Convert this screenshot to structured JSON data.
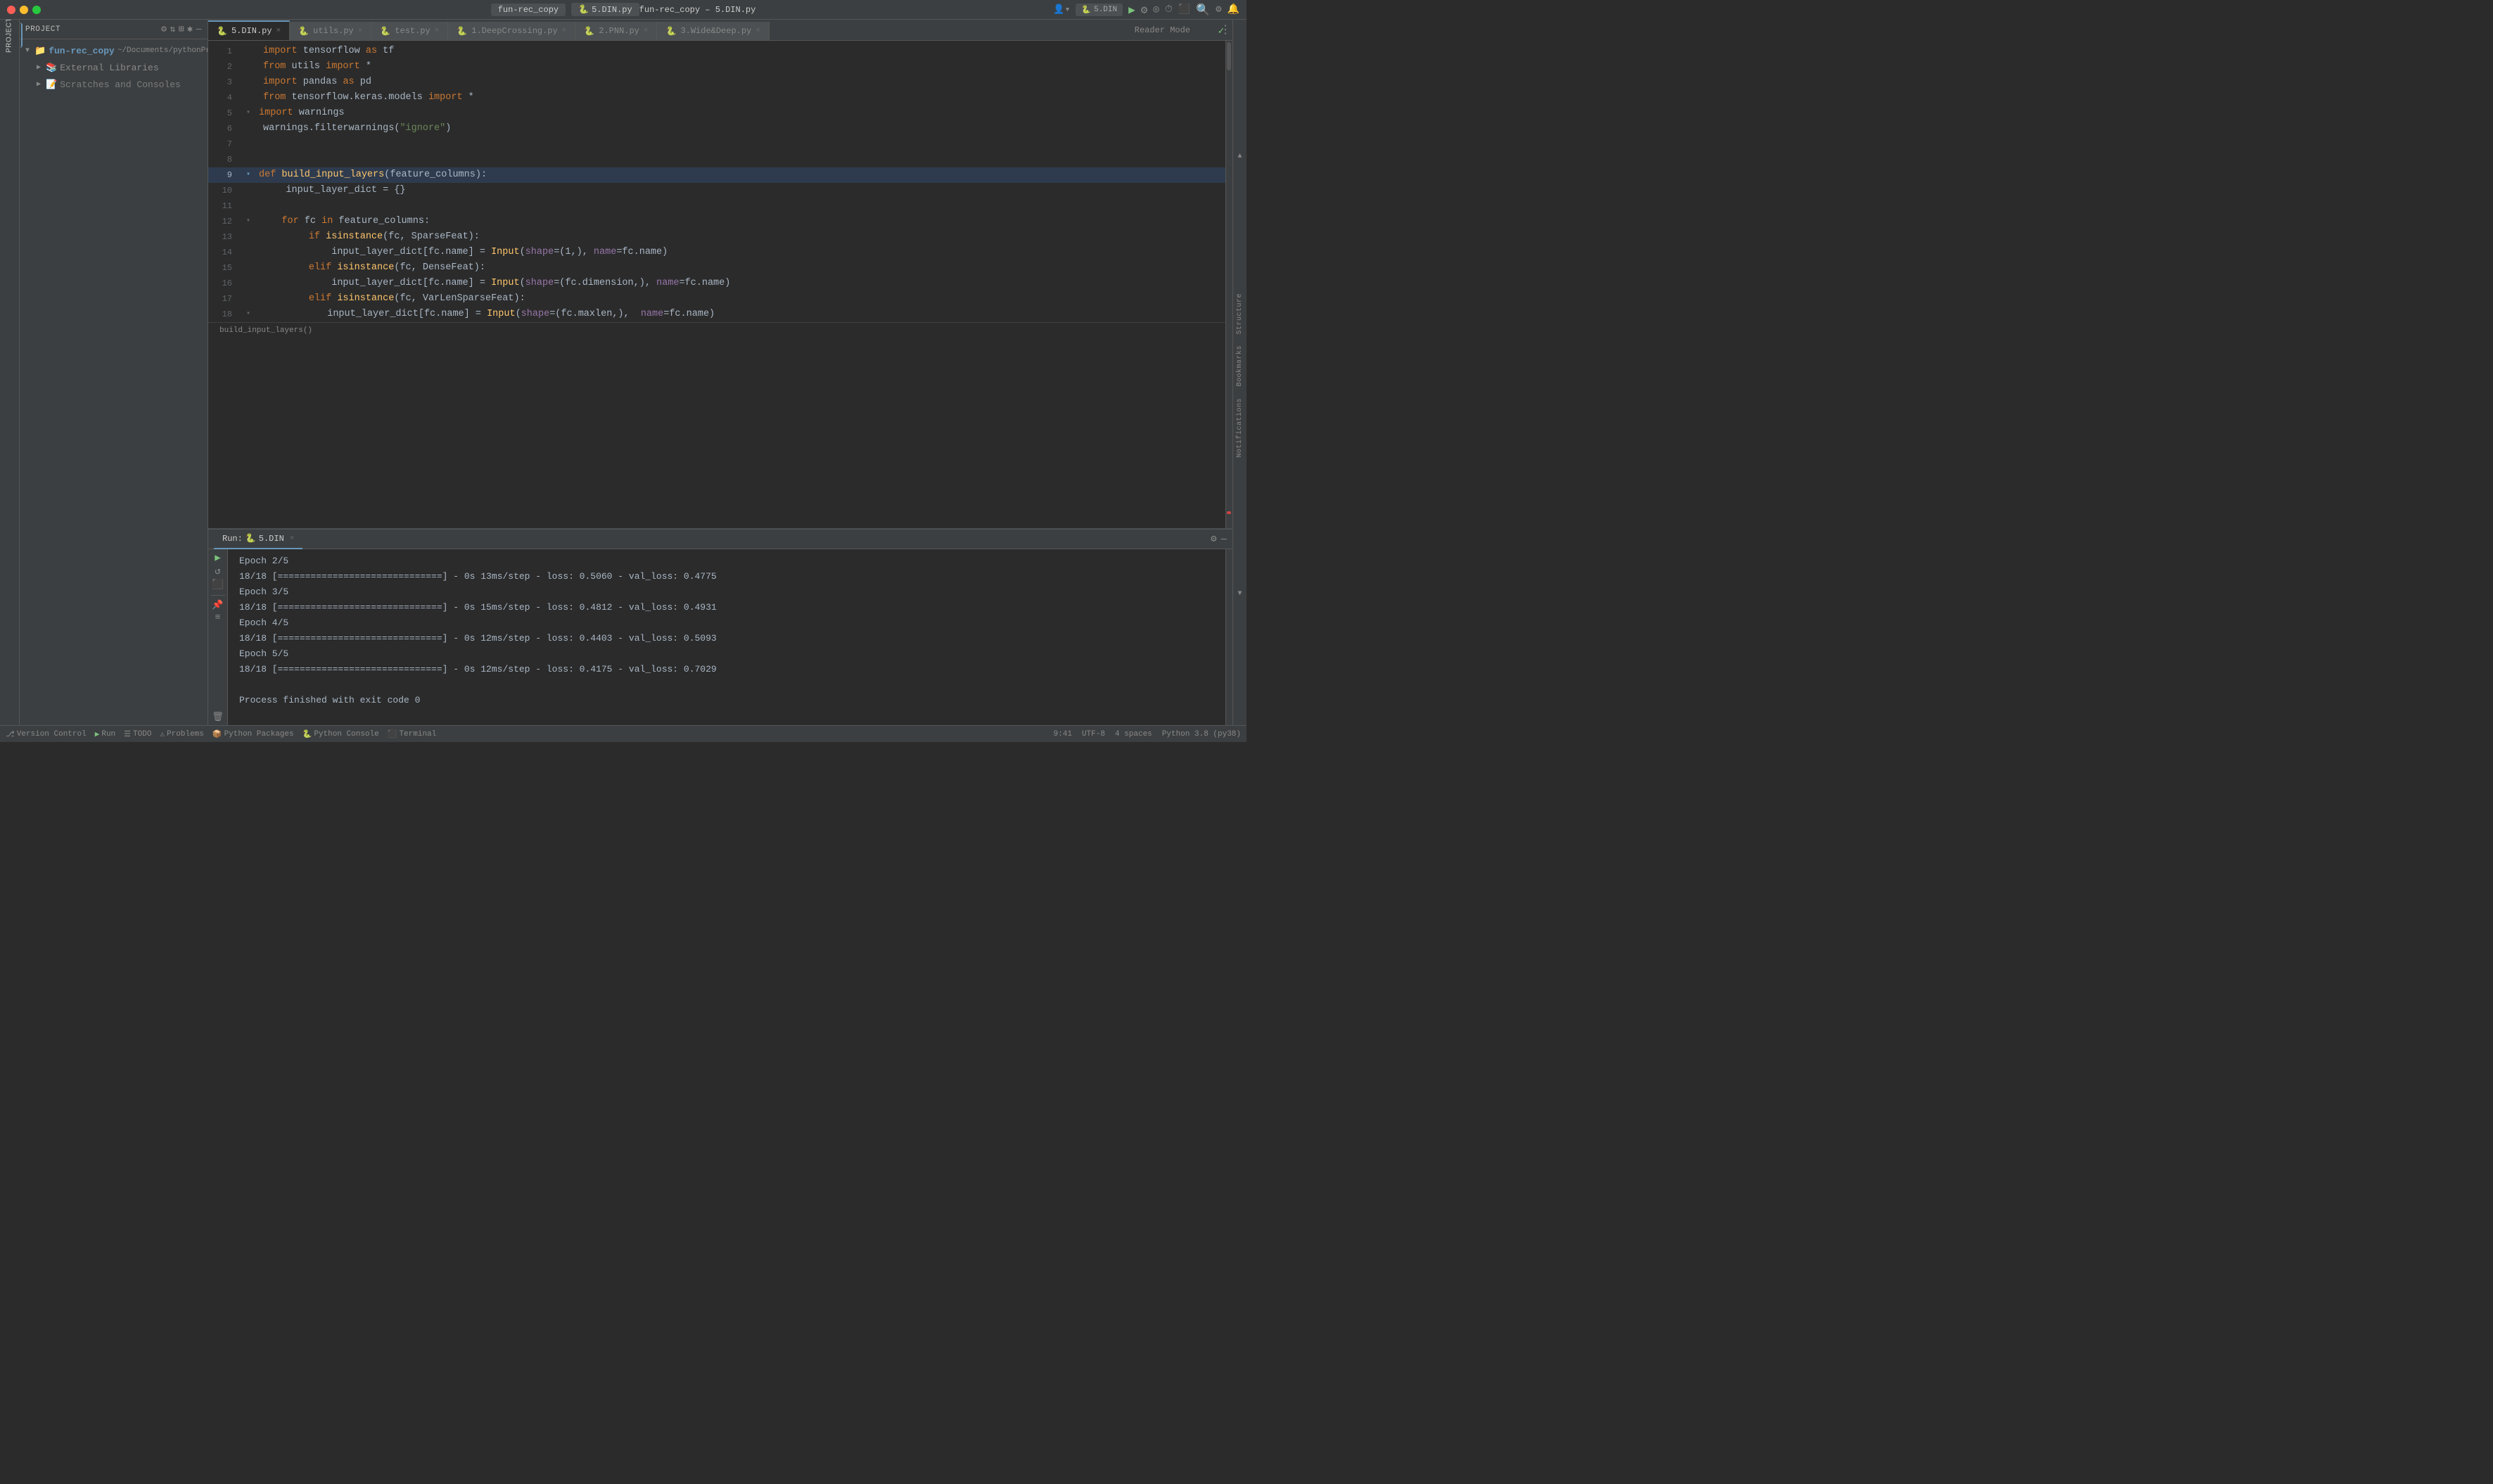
{
  "titlebar": {
    "title": "fun-rec_copy – 5.DIN.py",
    "project_tab": "fun-rec_copy",
    "file_tab": "5.DIN.py"
  },
  "toolbar": {
    "run_config": "5.DIN",
    "breadcrumb_func": "build_input_layers()"
  },
  "tabs": [
    {
      "label": "5.DIN.py",
      "active": true,
      "icon": "py"
    },
    {
      "label": "utils.py",
      "active": false,
      "icon": "py"
    },
    {
      "label": "test.py",
      "active": false,
      "icon": "py"
    },
    {
      "label": "1.DeepCrossing.py",
      "active": false,
      "icon": "py"
    },
    {
      "label": "2.PNN.py",
      "active": false,
      "icon": "py"
    },
    {
      "label": "3.Wide&Deep.py",
      "active": false,
      "icon": "py"
    }
  ],
  "code": {
    "lines": [
      {
        "num": 1,
        "content": "import tensorflow as tf",
        "tokens": [
          {
            "text": "import ",
            "cls": "kw"
          },
          {
            "text": "tensorflow ",
            "cls": ""
          },
          {
            "text": "as",
            "cls": "kw"
          },
          {
            "text": " tf",
            "cls": ""
          }
        ]
      },
      {
        "num": 2,
        "content": "from utils import *",
        "tokens": [
          {
            "text": "from ",
            "cls": "kw"
          },
          {
            "text": "utils ",
            "cls": ""
          },
          {
            "text": "import",
            "cls": "kw"
          },
          {
            "text": " *",
            "cls": ""
          }
        ]
      },
      {
        "num": 3,
        "content": "import pandas as pd",
        "tokens": [
          {
            "text": "import ",
            "cls": "kw"
          },
          {
            "text": "pandas ",
            "cls": ""
          },
          {
            "text": "as",
            "cls": "kw"
          },
          {
            "text": " pd",
            "cls": ""
          }
        ]
      },
      {
        "num": 4,
        "content": "from tensorflow.keras.models import *",
        "tokens": [
          {
            "text": "from ",
            "cls": "kw"
          },
          {
            "text": "tensorflow.keras.models ",
            "cls": ""
          },
          {
            "text": "import",
            "cls": "kw"
          },
          {
            "text": " *",
            "cls": ""
          }
        ]
      },
      {
        "num": 5,
        "content": "import warnings",
        "tokens": [
          {
            "text": "import ",
            "cls": "kw"
          },
          {
            "text": "warnings",
            "cls": ""
          }
        ]
      },
      {
        "num": 6,
        "content": "warnings.filterwarnings(\"ignore\")",
        "tokens": [
          {
            "text": "warnings.filterwarnings(",
            "cls": ""
          },
          {
            "text": "\"ignore\"",
            "cls": "str"
          },
          {
            "text": ")",
            "cls": ""
          }
        ]
      },
      {
        "num": 7,
        "content": "",
        "tokens": []
      },
      {
        "num": 8,
        "content": "",
        "tokens": []
      },
      {
        "num": 9,
        "content": "def build_input_layers(feature_columns):",
        "tokens": [
          {
            "text": "def ",
            "cls": "kw"
          },
          {
            "text": "build_input_layers",
            "cls": "fn"
          },
          {
            "text": "(",
            "cls": ""
          },
          {
            "text": "feature_columns",
            "cls": "param"
          },
          {
            "text": "):",
            "cls": ""
          }
        ]
      },
      {
        "num": 10,
        "content": "    input_layer_dict = {}",
        "tokens": [
          {
            "text": "    input_layer_dict = {}",
            "cls": ""
          }
        ]
      },
      {
        "num": 11,
        "content": "",
        "tokens": []
      },
      {
        "num": 12,
        "content": "    for fc in feature_columns:",
        "tokens": [
          {
            "text": "    ",
            "cls": ""
          },
          {
            "text": "for ",
            "cls": "kw"
          },
          {
            "text": "fc ",
            "cls": ""
          },
          {
            "text": "in",
            "cls": "kw"
          },
          {
            "text": " feature_columns:",
            "cls": ""
          }
        ]
      },
      {
        "num": 13,
        "content": "        if isinstance(fc, SparseFeat):",
        "tokens": [
          {
            "text": "        ",
            "cls": ""
          },
          {
            "text": "if ",
            "cls": "kw"
          },
          {
            "text": "isinstance",
            "cls": "fn"
          },
          {
            "text": "(fc, ",
            "cls": ""
          },
          {
            "text": "SparseFeat",
            "cls": "class-name"
          },
          {
            "text": "):",
            "cls": ""
          }
        ]
      },
      {
        "num": 14,
        "content": "            input_layer_dict[fc.name] = Input(shape=(1,), name=fc.name)",
        "tokens": [
          {
            "text": "            input_layer_dict[fc.name] = ",
            "cls": ""
          },
          {
            "text": "Input",
            "cls": "fn"
          },
          {
            "text": "(",
            "cls": ""
          },
          {
            "text": "shape",
            "cls": "name-kw"
          },
          {
            "text": "=(1,), ",
            "cls": ""
          },
          {
            "text": "name",
            "cls": "name-kw"
          },
          {
            "text": "=fc.name)",
            "cls": ""
          }
        ]
      },
      {
        "num": 15,
        "content": "        elif isinstance(fc, DenseFeat):",
        "tokens": [
          {
            "text": "        ",
            "cls": ""
          },
          {
            "text": "elif ",
            "cls": "kw"
          },
          {
            "text": "isinstance",
            "cls": "fn"
          },
          {
            "text": "(fc, ",
            "cls": ""
          },
          {
            "text": "DenseFeat",
            "cls": "class-name"
          },
          {
            "text": "):",
            "cls": ""
          }
        ]
      },
      {
        "num": 16,
        "content": "            input_layer_dict[fc.name] = Input(shape=(fc.dimension,), name=fc.name)",
        "tokens": [
          {
            "text": "            input_layer_dict[fc.name] = ",
            "cls": ""
          },
          {
            "text": "Input",
            "cls": "fn"
          },
          {
            "text": "(",
            "cls": ""
          },
          {
            "text": "shape",
            "cls": "name-kw"
          },
          {
            "text": "=(fc.dimension,), ",
            "cls": ""
          },
          {
            "text": "name",
            "cls": "name-kw"
          },
          {
            "text": "=fc.name)",
            "cls": ""
          }
        ]
      },
      {
        "num": 17,
        "content": "        elif isinstance(fc, VarLenSparseFeat):",
        "tokens": [
          {
            "text": "        ",
            "cls": ""
          },
          {
            "text": "elif ",
            "cls": "kw"
          },
          {
            "text": "isinstance",
            "cls": "fn"
          },
          {
            "text": "(fc, ",
            "cls": ""
          },
          {
            "text": "VarLenSparseFeat",
            "cls": "class-name"
          },
          {
            "text": "):",
            "cls": ""
          }
        ]
      },
      {
        "num": 18,
        "content": "            input_layer_dict[fc.name] = Input(shape=(fc.maxlen,),  name=fc.name)",
        "tokens": [
          {
            "text": "            input_layer_dict[fc.name] = ",
            "cls": ""
          },
          {
            "text": "Input",
            "cls": "fn"
          },
          {
            "text": "(",
            "cls": ""
          },
          {
            "text": "shape",
            "cls": "name-kw"
          },
          {
            "text": "=(fc.maxlen,),  ",
            "cls": ""
          },
          {
            "text": "name",
            "cls": "name-kw"
          },
          {
            "text": "=fc.name)",
            "cls": ""
          }
        ]
      }
    ]
  },
  "project_tree": {
    "root": "Project",
    "items": [
      {
        "label": "fun-rec_copy",
        "type": "folder",
        "path": "~/Documents/pythonProject/fu",
        "indent": 0,
        "expanded": true
      },
      {
        "label": "External Libraries",
        "type": "external",
        "indent": 1,
        "expanded": false
      },
      {
        "label": "Scratches and Consoles",
        "type": "scratches",
        "indent": 1,
        "expanded": false
      }
    ]
  },
  "bottom_panel": {
    "run_tab_label": "Run:",
    "run_config": "5.DIN",
    "output_lines": [
      "Epoch 2/5",
      "18/18 [==============================] - 0s 13ms/step - loss: 0.5060 - val_loss: 0.4775",
      "Epoch 3/5",
      "18/18 [==============================] - 0s 15ms/step - loss: 0.4812 - val_loss: 0.4931",
      "Epoch 4/5",
      "18/18 [==============================] - 0s 12ms/step - loss: 0.4403 - val_loss: 0.5093",
      "Epoch 5/5",
      "18/18 [==============================] - 0s 12ms/step - loss: 0.4175 - val_loss: 0.7029",
      "",
      "Process finished with exit code 0"
    ]
  },
  "statusbar": {
    "version_control": "Version Control",
    "run": "Run",
    "todo": "TODO",
    "problems": "Problems",
    "python_packages": "Python Packages",
    "python_console": "Python Console",
    "terminal": "Terminal",
    "time": "9:41",
    "encoding": "UTF-8",
    "indent": "4 spaces",
    "python_version": "Python 3.8 (py38)"
  },
  "icons": {
    "run": "▶",
    "stop": "⬛",
    "debug": "🐛",
    "settings": "⚙",
    "close": "×",
    "chevron_right": "›",
    "chevron_down": "∨",
    "folder": "📁",
    "file": "📄",
    "search": "🔍",
    "gear": "⚙",
    "structure": "Structure",
    "bookmarks": "Bookmarks",
    "notifications": "Notifications"
  }
}
